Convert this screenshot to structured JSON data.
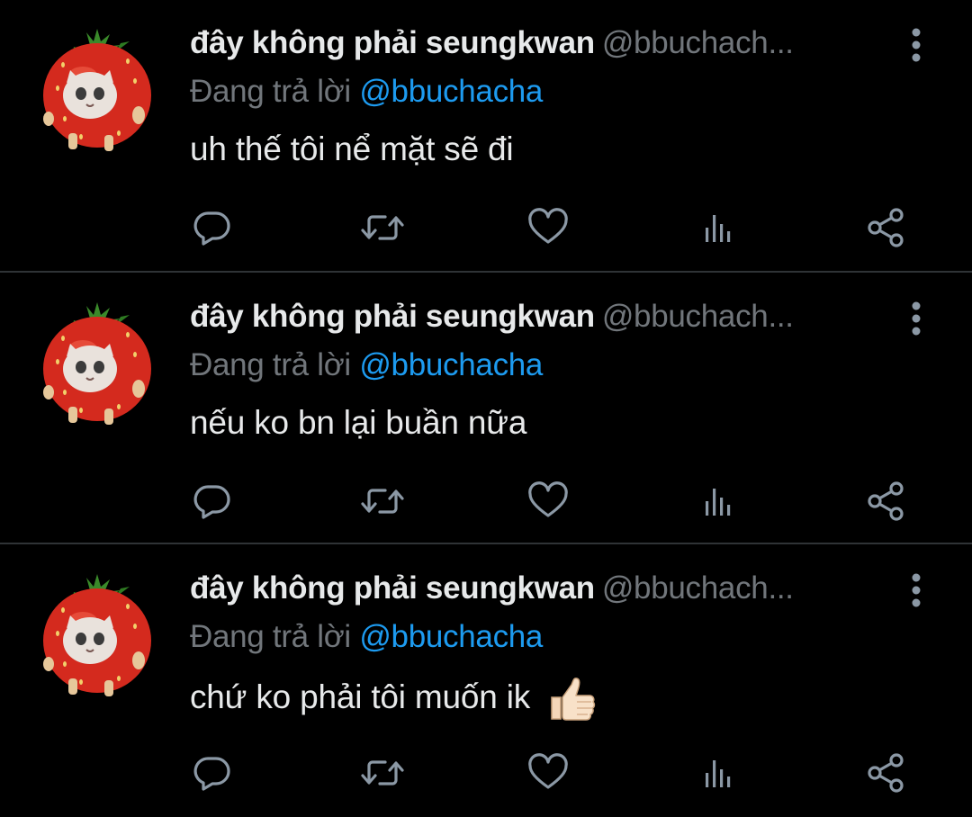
{
  "colors": {
    "background": "#000000",
    "primary_text": "#e7e9ea",
    "secondary_text": "#71767b",
    "accent": "#1d9bf0",
    "divider": "#2f3336",
    "icon": "#8b98a5"
  },
  "tweets": [
    {
      "display_name": "đây không phải seungkwan",
      "handle": "@bbuchach...",
      "reply_prefix": "Đang trả lời",
      "reply_to": "@bbuchacha",
      "text": "uh thế tôi nể mặt sẽ đi",
      "emoji": "",
      "avatar_icon": "strawberry-cat-avatar"
    },
    {
      "display_name": "đây không phải seungkwan",
      "handle": "@bbuchach...",
      "reply_prefix": "Đang trả lời",
      "reply_to": "@bbuchacha",
      "text": "nếu ko bn lại buần nữa",
      "emoji": "",
      "avatar_icon": "strawberry-cat-avatar"
    },
    {
      "display_name": "đây không phải seungkwan",
      "handle": "@bbuchach...",
      "reply_prefix": "Đang trả lời",
      "reply_to": "@bbuchacha",
      "text": "chứ ko phải tôi muốn ik",
      "emoji": "thumbs-up",
      "avatar_icon": "strawberry-cat-avatar"
    }
  ],
  "action_icons": [
    "reply-icon",
    "retweet-icon",
    "like-icon",
    "views-icon",
    "share-icon"
  ]
}
